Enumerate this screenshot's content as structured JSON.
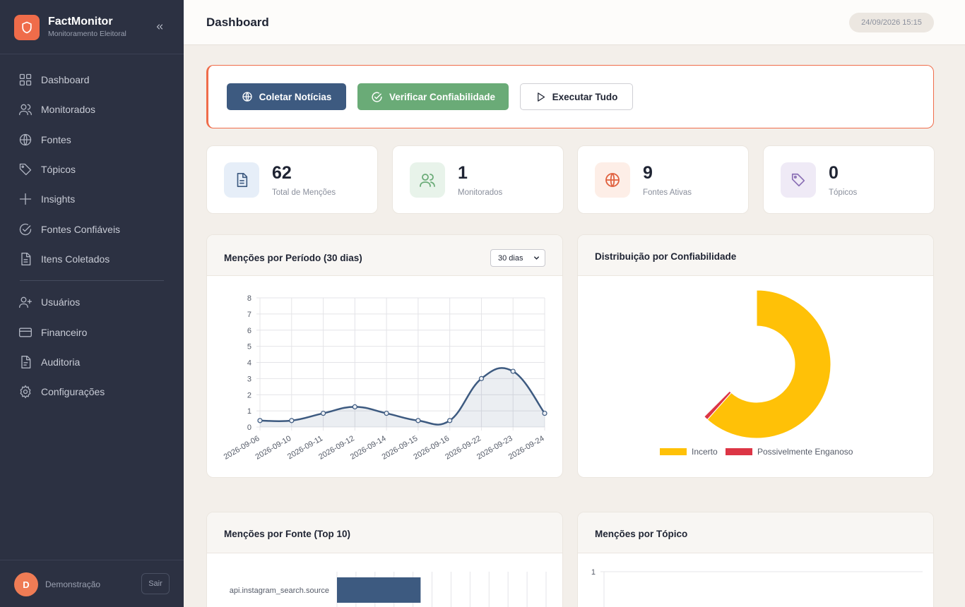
{
  "app": {
    "name": "FactMonitor",
    "subtitle": "Monitoramento Eleitoral"
  },
  "sidebar": {
    "items": [
      {
        "label": "Dashboard",
        "icon": "grid-icon"
      },
      {
        "label": "Monitorados",
        "icon": "users-icon"
      },
      {
        "label": "Fontes",
        "icon": "globe-icon"
      },
      {
        "label": "Tópicos",
        "icon": "tag-icon"
      },
      {
        "label": "Insights",
        "icon": "plus-icon"
      },
      {
        "label": "Fontes Confiáveis",
        "icon": "check-circle-icon"
      },
      {
        "label": "Itens Coletados",
        "icon": "document-icon"
      },
      {
        "label": "Usuários",
        "icon": "user-plus-icon"
      },
      {
        "label": "Financeiro",
        "icon": "credit-card-icon"
      },
      {
        "label": "Auditoria",
        "icon": "file-text-icon"
      },
      {
        "label": "Configurações",
        "icon": "gear-icon"
      }
    ],
    "user": {
      "initial": "D",
      "name": "Demonstração",
      "logout_label": "Sair"
    }
  },
  "header": {
    "title": "Dashboard",
    "datetime": "24/09/2026 15:15"
  },
  "actions": {
    "collect_label": "Coletar Notícias",
    "verify_label": "Verificar Confiabilidade",
    "run_label": "Executar Tudo"
  },
  "stats": [
    {
      "value": "62",
      "label": "Total de Menções",
      "icon": "document-icon"
    },
    {
      "value": "1",
      "label": "Monitorados",
      "icon": "users-icon"
    },
    {
      "value": "9",
      "label": "Fontes Ativas",
      "icon": "globe-icon"
    },
    {
      "value": "0",
      "label": "Tópicos",
      "icon": "tag-icon"
    }
  ],
  "panels": {
    "mentions_period": {
      "title": "Menções por Período (30 dias)",
      "range_value": "30 dias"
    },
    "reliability": {
      "title": "Distribuição por Confiabilidade"
    },
    "by_source": {
      "title": "Menções por Fonte (Top 10)"
    },
    "by_topic": {
      "title": "Menções por Tópico"
    }
  },
  "colors": {
    "accent": "#ef6c4a",
    "primary": "#3d5a80",
    "success": "#6aab77",
    "sidebar_bg": "#2c3142",
    "uncertain": "#ffc107",
    "misleading": "#dc3545"
  },
  "chart_data": [
    {
      "type": "line",
      "title": "",
      "x": [
        "2026-09-06",
        "2026-09-10",
        "2026-09-11",
        "2026-09-12",
        "2026-09-14",
        "2026-09-15",
        "2026-09-16",
        "2026-09-22",
        "2026-09-23",
        "2026-09-24"
      ],
      "series": [
        {
          "values": [
            0.4,
            0.4,
            0.85,
            1.25,
            0.85,
            0.4,
            0.4,
            3.0,
            3.45,
            0.85
          ]
        }
      ],
      "ylim": [
        0,
        8
      ],
      "yticks": [
        "0",
        "1",
        "2",
        "3",
        "4",
        "5",
        "6",
        "7",
        "8"
      ],
      "grid": true,
      "fill": true,
      "color": "#3d5a80"
    },
    {
      "type": "pie",
      "title": "",
      "categories": [
        "Incerto",
        "Possivelmente Enganoso"
      ],
      "values": [
        98.5,
        1.5
      ],
      "colors": [
        "#ffc107",
        "#dc3545"
      ],
      "legend": "bottom"
    },
    {
      "type": "bar",
      "orientation": "horizontal",
      "title": "",
      "categories": [
        "api.instagram_search.source"
      ],
      "values": [
        4.4
      ],
      "grid": true,
      "color": "#3d5a80"
    },
    {
      "type": "bar",
      "title": "",
      "categories": [],
      "values": [],
      "yticks": [
        "1"
      ],
      "grid": true
    }
  ]
}
